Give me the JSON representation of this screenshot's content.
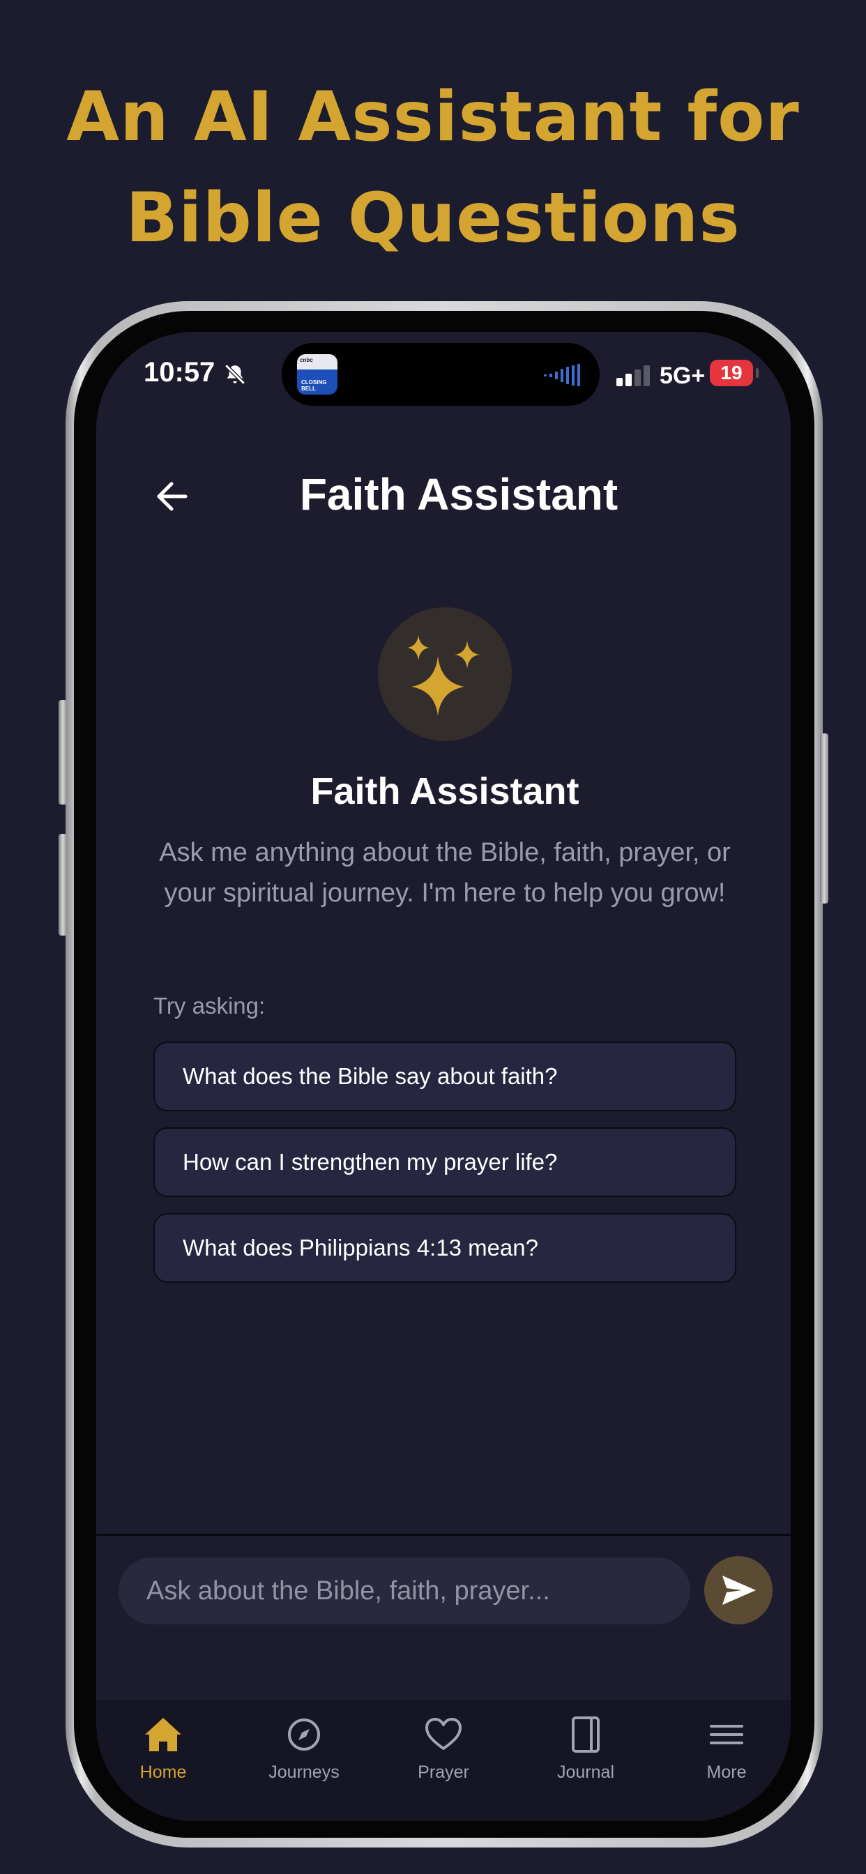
{
  "promo": {
    "line1": "An AI Assistant for",
    "line2": "Bible Questions"
  },
  "status_bar": {
    "time": "10:57",
    "activity_app_text": "CLOSING BELL",
    "activity_app_brand": "cnbc",
    "network": "5G+",
    "battery": "19"
  },
  "header": {
    "title": "Faith Assistant"
  },
  "hero": {
    "title": "Faith Assistant",
    "description": "Ask me anything about the Bible, faith, prayer, or your spiritual journey. I'm here to help you grow!"
  },
  "suggestions": {
    "label": "Try asking:",
    "items": [
      "What does the Bible say about faith?",
      "How can I strengthen my prayer life?",
      "What does Philippians 4:13 mean?"
    ]
  },
  "composer": {
    "placeholder": "Ask about the Bible, faith, prayer..."
  },
  "tabs": [
    {
      "label": "Home",
      "icon": "home-icon",
      "active": true
    },
    {
      "label": "Journeys",
      "icon": "compass-icon",
      "active": false
    },
    {
      "label": "Prayer",
      "icon": "heart-icon",
      "active": false
    },
    {
      "label": "Journal",
      "icon": "journal-icon",
      "active": false
    },
    {
      "label": "More",
      "icon": "menu-icon",
      "active": false
    }
  ],
  "colors": {
    "background": "#1b1c2e",
    "accent_gold": "#d4a531",
    "card": "#262641",
    "muted_text": "#9b9cab"
  }
}
